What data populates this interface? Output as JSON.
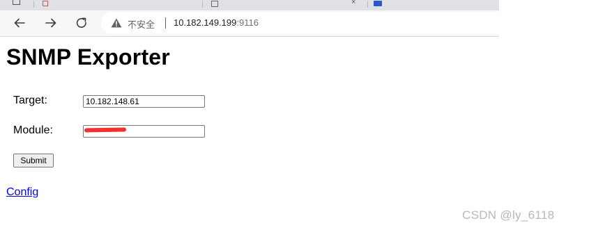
{
  "browser": {
    "address_bar": {
      "security_label": "不安全",
      "url_host": "10.182.149.199",
      "url_port": ":9116"
    }
  },
  "page": {
    "title": "SNMP Exporter",
    "form": {
      "target_label": "Target:",
      "target_value": "10.182.148.61",
      "module_label": "Module:",
      "module_value": "",
      "submit_label": "Submit"
    },
    "config_link": "Config"
  },
  "watermark": "CSDN @ly_6118"
}
